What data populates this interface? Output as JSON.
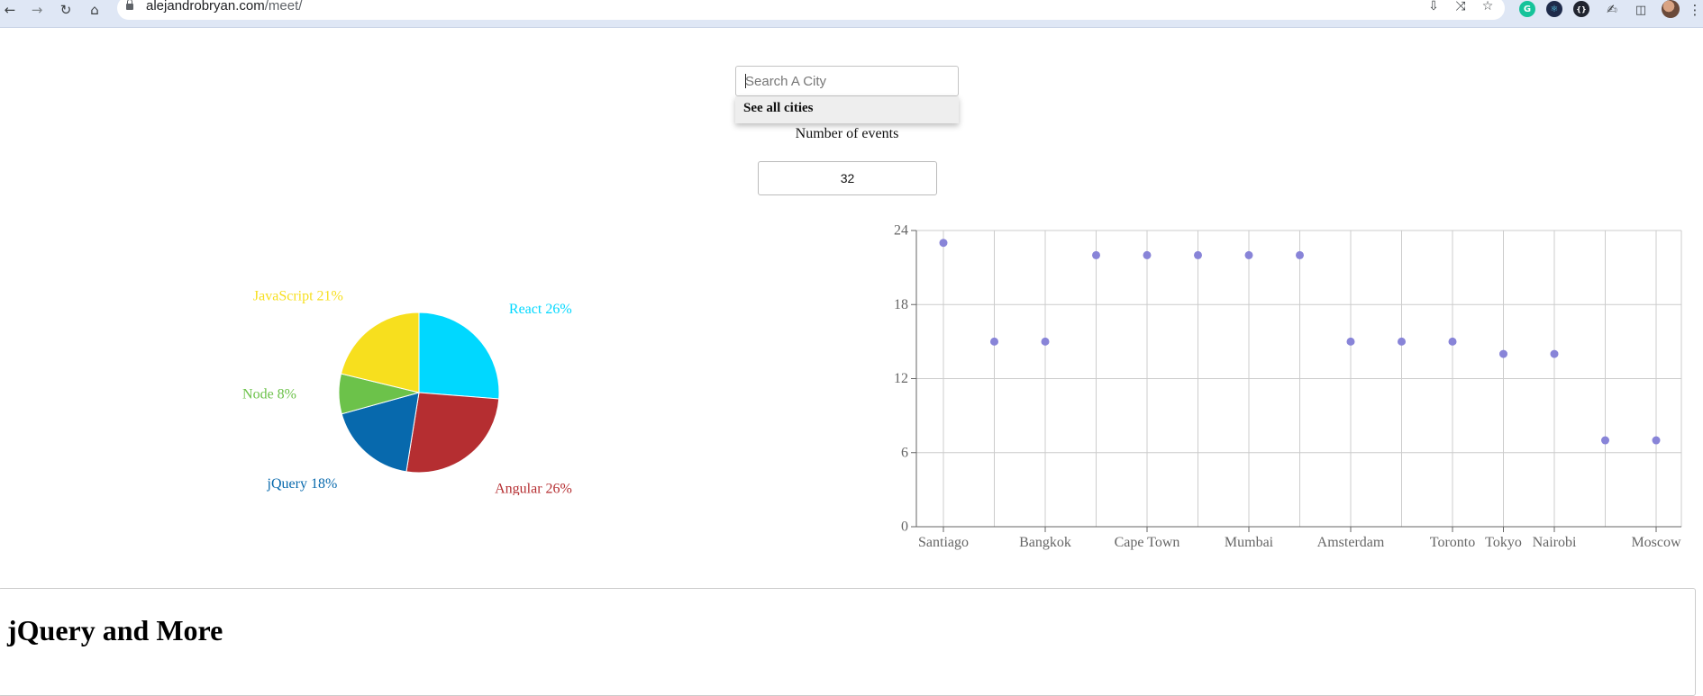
{
  "browser": {
    "url_domain": "alejandrobryan.com",
    "url_path": "/meet/",
    "icons": [
      "back-icon",
      "forward-icon",
      "reload-icon",
      "home-icon",
      "lock-icon",
      "install-icon",
      "share-icon",
      "bookmark-star-icon",
      "grammarly-icon",
      "react-devtools-icon",
      "json-viewer-icon",
      "extensions-icon",
      "side-panel-icon",
      "profile-avatar",
      "menu-icon"
    ]
  },
  "search": {
    "placeholder": "Search A City",
    "suggestion": "See all cities"
  },
  "events": {
    "label": "Number of events",
    "value": "32"
  },
  "pie": {
    "colors": {
      "React": "#00d8ff",
      "Angular": "#b52e31",
      "jQuery": "#0769ad",
      "Node": "#6cc24a",
      "JavaScript": "#f7df1e"
    },
    "slices": [
      {
        "name": "React",
        "label": "React 26%",
        "percent": 26,
        "color": "#00d8ff"
      },
      {
        "name": "Angular",
        "label": "Angular 26%",
        "percent": 26,
        "color": "#b52e31"
      },
      {
        "name": "jQuery",
        "label": "jQuery 18%",
        "percent": 18,
        "color": "#0769ad"
      },
      {
        "name": "Node",
        "label": "Node 8%",
        "percent": 8,
        "color": "#6cc24a"
      },
      {
        "name": "JavaScript",
        "label": "JavaScript 21%",
        "percent": 21,
        "color": "#f7df1e"
      }
    ]
  },
  "chart_data": [
    {
      "type": "pie",
      "labels": [
        "React 26%",
        "Angular 26%",
        "jQuery 18%",
        "Node 8%",
        "JavaScript 21%"
      ],
      "values": [
        26,
        26,
        18,
        8,
        21
      ]
    },
    {
      "type": "scatter",
      "point_color": "#8884d8",
      "grid": true,
      "ylim": [
        0,
        24
      ],
      "y_ticks": [
        0,
        6,
        12,
        18,
        24
      ],
      "x_tick_labels": [
        "Santiago",
        "Bangkok",
        "Cape Town",
        "Mumbai",
        "Amsterdam",
        "Toronto",
        "Tokyo",
        "Nairobi",
        "Moscow"
      ],
      "points": [
        {
          "x": "Santiago",
          "y": 23,
          "labeled": true
        },
        {
          "x": "",
          "y": 15,
          "labeled": false
        },
        {
          "x": "Bangkok",
          "y": 15,
          "labeled": true
        },
        {
          "x": "",
          "y": 22,
          "labeled": false
        },
        {
          "x": "Cape Town",
          "y": 22,
          "labeled": true
        },
        {
          "x": "",
          "y": 22,
          "labeled": false
        },
        {
          "x": "Mumbai",
          "y": 22,
          "labeled": true
        },
        {
          "x": "",
          "y": 22,
          "labeled": false
        },
        {
          "x": "Amsterdam",
          "y": 15,
          "labeled": true
        },
        {
          "x": "",
          "y": 15,
          "labeled": false
        },
        {
          "x": "Toronto",
          "y": 15,
          "labeled": true
        },
        {
          "x": "Tokyo",
          "y": 14,
          "labeled": true
        },
        {
          "x": "Nairobi",
          "y": 14,
          "labeled": true
        },
        {
          "x": "",
          "y": 7,
          "labeled": false
        },
        {
          "x": "Moscow",
          "y": 7,
          "labeled": true
        }
      ]
    }
  ],
  "event": {
    "title": "jQuery and More"
  }
}
